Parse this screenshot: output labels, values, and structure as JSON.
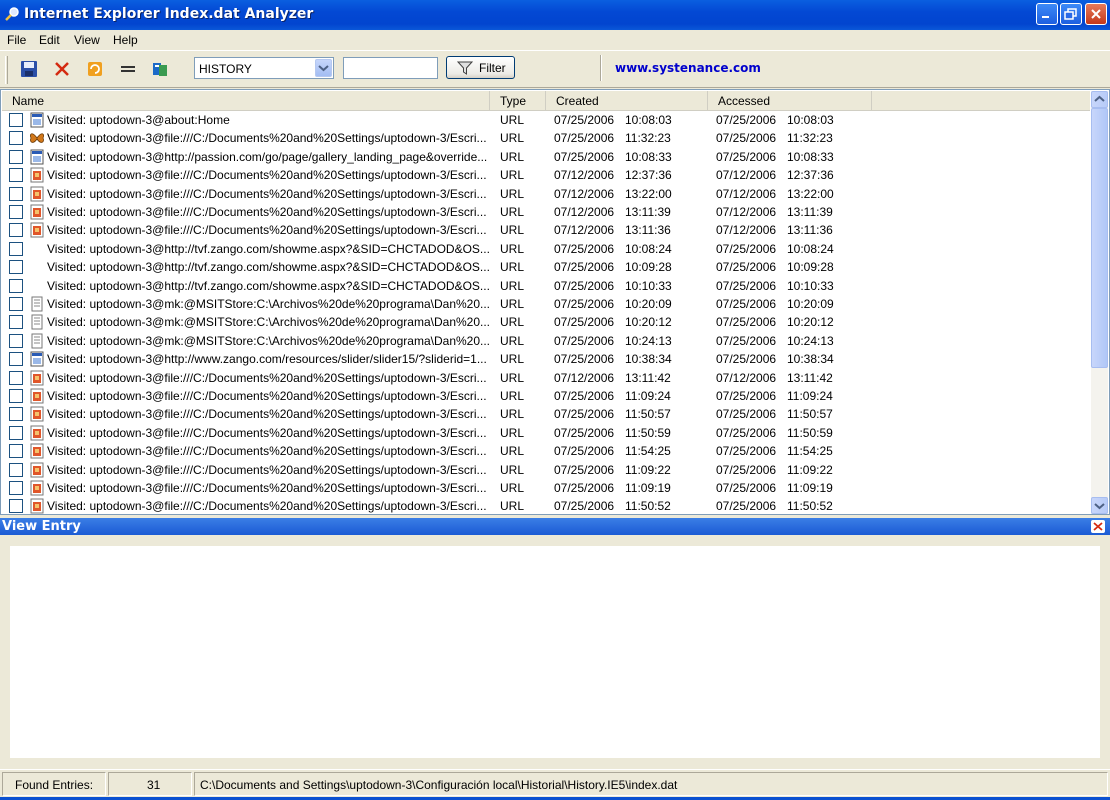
{
  "app": {
    "title": "Internet Explorer Index.dat Analyzer"
  },
  "menu": {
    "items": [
      "File",
      "Edit",
      "View",
      "Help"
    ]
  },
  "toolbar": {
    "buttons": [
      "save-icon",
      "delete-icon",
      "refresh-icon",
      "equal-icon",
      "open-file-icon"
    ],
    "select_value": "HISTORY",
    "filter_value": "",
    "filter_label": "Filter",
    "site_link": "www.systenance.com"
  },
  "list": {
    "columns": [
      "Name",
      "Type",
      "Created",
      "Accessed"
    ],
    "rows": [
      {
        "icon": "page-icon",
        "name": "Visited: uptodown-3@about:Home",
        "type": "URL",
        "created_date": "07/25/2006",
        "created_time": "10:08:03",
        "accessed_date": "07/25/2006",
        "accessed_time": "10:08:03"
      },
      {
        "icon": "butterfly-icon",
        "name": "Visited: uptodown-3@file:///C:/Documents%20and%20Settings/uptodown-3/Escri...",
        "type": "URL",
        "created_date": "07/25/2006",
        "created_time": "11:32:23",
        "accessed_date": "07/25/2006",
        "accessed_time": "11:32:23"
      },
      {
        "icon": "page-icon",
        "name": "Visited: uptodown-3@http://passion.com/go/page/gallery_landing_page&override...",
        "type": "URL",
        "created_date": "07/25/2006",
        "created_time": "10:08:33",
        "accessed_date": "07/25/2006",
        "accessed_time": "10:08:33"
      },
      {
        "icon": "image-file-icon",
        "name": "Visited: uptodown-3@file:///C:/Documents%20and%20Settings/uptodown-3/Escri...",
        "type": "URL",
        "created_date": "07/12/2006",
        "created_time": "12:37:36",
        "accessed_date": "07/12/2006",
        "accessed_time": "12:37:36"
      },
      {
        "icon": "image-file-icon",
        "name": "Visited: uptodown-3@file:///C:/Documents%20and%20Settings/uptodown-3/Escri...",
        "type": "URL",
        "created_date": "07/12/2006",
        "created_time": "13:22:00",
        "accessed_date": "07/12/2006",
        "accessed_time": "13:22:00"
      },
      {
        "icon": "image-file-icon",
        "name": "Visited: uptodown-3@file:///C:/Documents%20and%20Settings/uptodown-3/Escri...",
        "type": "URL",
        "created_date": "07/12/2006",
        "created_time": "13:11:39",
        "accessed_date": "07/12/2006",
        "accessed_time": "13:11:39"
      },
      {
        "icon": "image-file-icon",
        "name": "Visited: uptodown-3@file:///C:/Documents%20and%20Settings/uptodown-3/Escri...",
        "type": "URL",
        "created_date": "07/12/2006",
        "created_time": "13:11:36",
        "accessed_date": "07/12/2006",
        "accessed_time": "13:11:36"
      },
      {
        "icon": "",
        "name": "Visited: uptodown-3@http://tvf.zango.com/showme.aspx?&SID=CHCTADOD&OS...",
        "type": "URL",
        "created_date": "07/25/2006",
        "created_time": "10:08:24",
        "accessed_date": "07/25/2006",
        "accessed_time": "10:08:24"
      },
      {
        "icon": "",
        "name": "Visited: uptodown-3@http://tvf.zango.com/showme.aspx?&SID=CHCTADOD&OS...",
        "type": "URL",
        "created_date": "07/25/2006",
        "created_time": "10:09:28",
        "accessed_date": "07/25/2006",
        "accessed_time": "10:09:28"
      },
      {
        "icon": "",
        "name": "Visited: uptodown-3@http://tvf.zango.com/showme.aspx?&SID=CHCTADOD&OS...",
        "type": "URL",
        "created_date": "07/25/2006",
        "created_time": "10:10:33",
        "accessed_date": "07/25/2006",
        "accessed_time": "10:10:33"
      },
      {
        "icon": "document-icon",
        "name": "Visited: uptodown-3@mk:@MSITStore:C:\\Archivos%20de%20programa\\Dan%20...",
        "type": "URL",
        "created_date": "07/25/2006",
        "created_time": "10:20:09",
        "accessed_date": "07/25/2006",
        "accessed_time": "10:20:09"
      },
      {
        "icon": "document-icon",
        "name": "Visited: uptodown-3@mk:@MSITStore:C:\\Archivos%20de%20programa\\Dan%20...",
        "type": "URL",
        "created_date": "07/25/2006",
        "created_time": "10:20:12",
        "accessed_date": "07/25/2006",
        "accessed_time": "10:20:12"
      },
      {
        "icon": "document-icon",
        "name": "Visited: uptodown-3@mk:@MSITStore:C:\\Archivos%20de%20programa\\Dan%20...",
        "type": "URL",
        "created_date": "07/25/2006",
        "created_time": "10:24:13",
        "accessed_date": "07/25/2006",
        "accessed_time": "10:24:13"
      },
      {
        "icon": "page-icon",
        "name": "Visited: uptodown-3@http://www.zango.com/resources/slider/slider15/?sliderid=1...",
        "type": "URL",
        "created_date": "07/25/2006",
        "created_time": "10:38:34",
        "accessed_date": "07/25/2006",
        "accessed_time": "10:38:34"
      },
      {
        "icon": "image-file-icon",
        "name": "Visited: uptodown-3@file:///C:/Documents%20and%20Settings/uptodown-3/Escri...",
        "type": "URL",
        "created_date": "07/12/2006",
        "created_time": "13:11:42",
        "accessed_date": "07/12/2006",
        "accessed_time": "13:11:42"
      },
      {
        "icon": "image-file-icon",
        "name": "Visited: uptodown-3@file:///C:/Documents%20and%20Settings/uptodown-3/Escri...",
        "type": "URL",
        "created_date": "07/25/2006",
        "created_time": "11:09:24",
        "accessed_date": "07/25/2006",
        "accessed_time": "11:09:24"
      },
      {
        "icon": "image-file-icon",
        "name": "Visited: uptodown-3@file:///C:/Documents%20and%20Settings/uptodown-3/Escri...",
        "type": "URL",
        "created_date": "07/25/2006",
        "created_time": "11:50:57",
        "accessed_date": "07/25/2006",
        "accessed_time": "11:50:57"
      },
      {
        "icon": "image-file-icon",
        "name": "Visited: uptodown-3@file:///C:/Documents%20and%20Settings/uptodown-3/Escri...",
        "type": "URL",
        "created_date": "07/25/2006",
        "created_time": "11:50:59",
        "accessed_date": "07/25/2006",
        "accessed_time": "11:50:59"
      },
      {
        "icon": "image-file-icon",
        "name": "Visited: uptodown-3@file:///C:/Documents%20and%20Settings/uptodown-3/Escri...",
        "type": "URL",
        "created_date": "07/25/2006",
        "created_time": "11:54:25",
        "accessed_date": "07/25/2006",
        "accessed_time": "11:54:25"
      },
      {
        "icon": "image-file-icon",
        "name": "Visited: uptodown-3@file:///C:/Documents%20and%20Settings/uptodown-3/Escri...",
        "type": "URL",
        "created_date": "07/25/2006",
        "created_time": "11:09:22",
        "accessed_date": "07/25/2006",
        "accessed_time": "11:09:22"
      },
      {
        "icon": "image-file-icon",
        "name": "Visited: uptodown-3@file:///C:/Documents%20and%20Settings/uptodown-3/Escri...",
        "type": "URL",
        "created_date": "07/25/2006",
        "created_time": "11:09:19",
        "accessed_date": "07/25/2006",
        "accessed_time": "11:09:19"
      },
      {
        "icon": "image-file-icon",
        "name": "Visited: uptodown-3@file:///C:/Documents%20and%20Settings/uptodown-3/Escri...",
        "type": "URL",
        "created_date": "07/25/2006",
        "created_time": "11:50:52",
        "accessed_date": "07/25/2006",
        "accessed_time": "11:50:52"
      }
    ]
  },
  "panel": {
    "title": "View Entry",
    "content": ""
  },
  "status": {
    "found_label": "Found Entries:",
    "found_count": "31",
    "path": "C:\\Documents and Settings\\uptodown-3\\Configuración local\\Historial\\History.IE5\\index.dat"
  },
  "colors": {
    "titlebar": "#0348d4",
    "link": "#0000cc",
    "panel_title": "#1b5bd4"
  }
}
